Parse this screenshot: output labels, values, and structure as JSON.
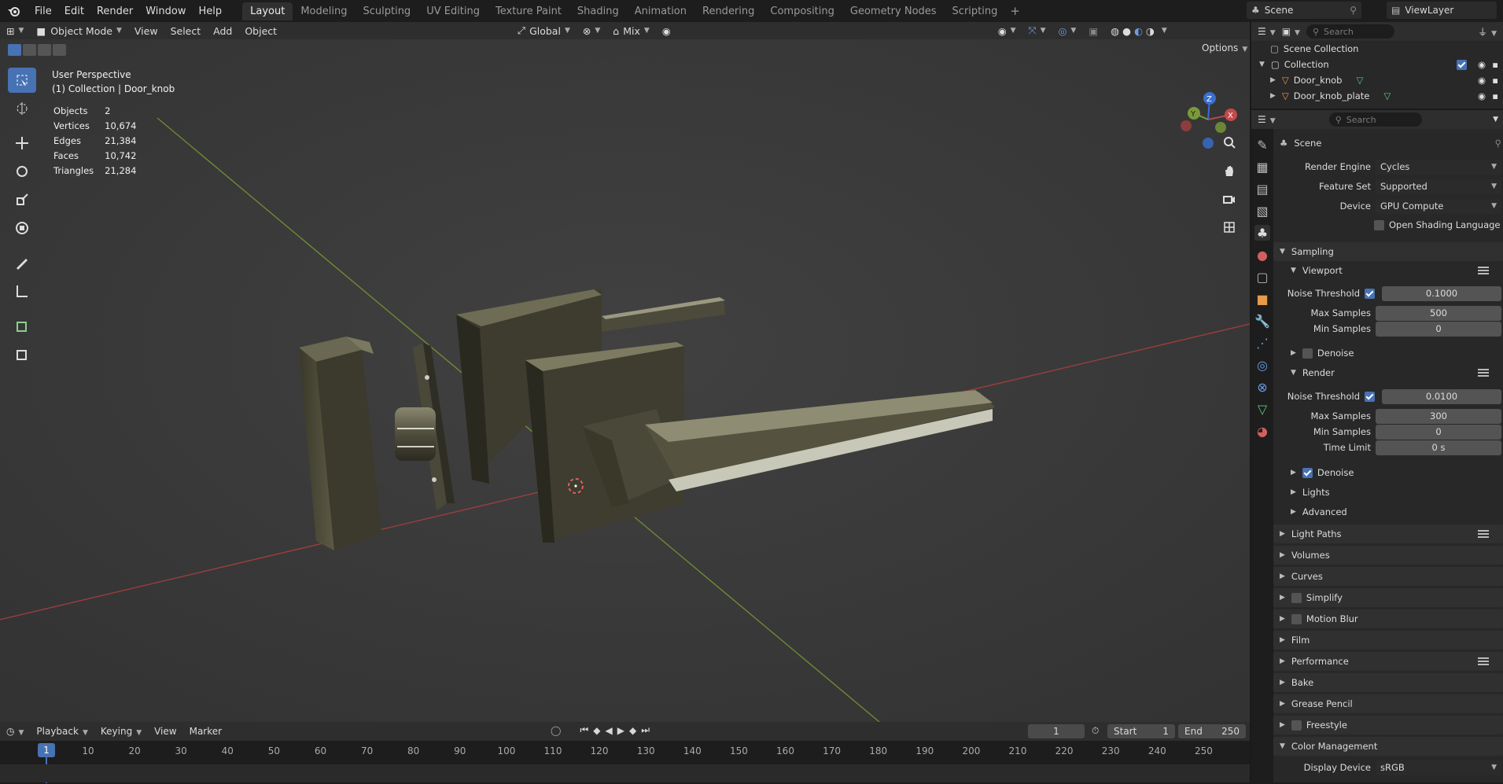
{
  "topbar": {
    "menus": [
      "File",
      "Edit",
      "Render",
      "Window",
      "Help"
    ],
    "workspaces": [
      "Layout",
      "Modeling",
      "Sculpting",
      "UV Editing",
      "Texture Paint",
      "Shading",
      "Animation",
      "Rendering",
      "Compositing",
      "Geometry Nodes",
      "Scripting"
    ],
    "active_workspace": "Layout",
    "scene": "Scene",
    "view_layer": "ViewLayer"
  },
  "viewport": {
    "mode": "Object Mode",
    "menus": [
      "View",
      "Select",
      "Add",
      "Object"
    ],
    "orientation": "Global",
    "snap_mode": "Mix",
    "options_label": "Options",
    "view_name": "User Perspective",
    "view_context": "(1) Collection | Door_knob",
    "stats": [
      {
        "label": "Objects",
        "value": "2"
      },
      {
        "label": "Vertices",
        "value": "10,674"
      },
      {
        "label": "Edges",
        "value": "21,384"
      },
      {
        "label": "Faces",
        "value": "10,742"
      },
      {
        "label": "Triangles",
        "value": "21,284"
      }
    ],
    "gizmo_axes": [
      "X",
      "Y",
      "Z"
    ]
  },
  "timeline": {
    "menus": [
      "Playback",
      "Keying",
      "View",
      "Marker"
    ],
    "current_frame": "1",
    "start_label": "Start",
    "start": "1",
    "end_label": "End",
    "end": "250",
    "ticks": [
      "1",
      "10",
      "20",
      "30",
      "40",
      "50",
      "60",
      "70",
      "80",
      "90",
      "100",
      "110",
      "120",
      "130",
      "140",
      "150",
      "160",
      "170",
      "180",
      "190",
      "200",
      "210",
      "220",
      "230",
      "240",
      "250"
    ]
  },
  "outliner": {
    "search_placeholder": "Search",
    "scene_collection": "Scene Collection",
    "collection": "Collection",
    "objects": [
      "Door_knob",
      "Door_knob_plate"
    ]
  },
  "properties": {
    "search_placeholder": "Search",
    "context": "Scene",
    "render_engine_label": "Render Engine",
    "render_engine": "Cycles",
    "feature_set_label": "Feature Set",
    "feature_set": "Supported",
    "device_label": "Device",
    "device": "GPU Compute",
    "osl_label": "Open Shading Language",
    "sampling": "Sampling",
    "viewport": "Viewport",
    "noise_threshold_label": "Noise Threshold",
    "vp_noise_threshold": "0.1000",
    "max_samples_label": "Max Samples",
    "vp_max_samples": "500",
    "min_samples_label": "Min Samples",
    "vp_min_samples": "0",
    "denoise_label": "Denoise",
    "render": "Render",
    "r_noise_threshold": "0.0100",
    "r_max_samples": "300",
    "r_min_samples": "0",
    "time_limit_label": "Time Limit",
    "r_time_limit": "0 s",
    "lights": "Lights",
    "advanced": "Advanced",
    "panels": [
      "Light Paths",
      "Volumes",
      "Curves",
      "Simplify",
      "Motion Blur",
      "Film",
      "Performance",
      "Bake",
      "Grease Pencil",
      "Freestyle",
      "Color Management"
    ],
    "display_device_label": "Display Device",
    "display_device": "sRGB"
  },
  "colors": {
    "accent": "#4772b3",
    "x_axis": "#b44a4a",
    "y_axis": "#7a9a3a",
    "z_axis": "#3a6fd1"
  }
}
